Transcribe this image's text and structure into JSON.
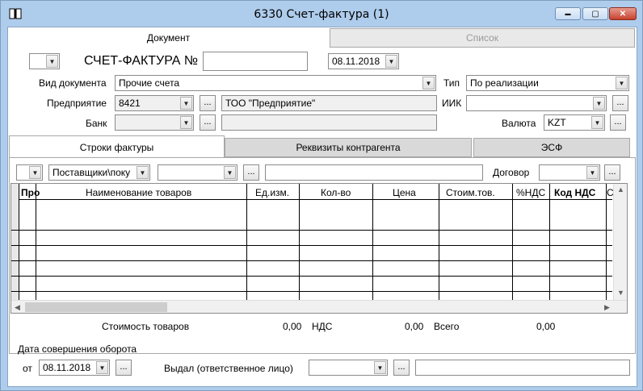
{
  "window": {
    "title": "6330 Счет-фактура (1)",
    "minimize": "▬",
    "maximize": "▢",
    "close": "✕"
  },
  "top_tabs": {
    "document": "Документ",
    "list": "Список"
  },
  "header": {
    "doc_title": "СЧЕТ-ФАКТУРА №",
    "number_value": "",
    "date_value": "08.11.2018",
    "doc_type_label": "Вид документа",
    "doc_type_value": "Прочие счета",
    "type_label": "Тип",
    "type_value": "По реализации",
    "enterprise_label": "Предприятие",
    "enterprise_code": "8421",
    "enterprise_name": "ТОО \"Предприятие\"",
    "iik_label": "ИИК",
    "iik_value": "",
    "bank_label": "Банк",
    "bank_value": "",
    "currency_label": "Валюта",
    "currency_value": "KZT"
  },
  "inner_tabs": {
    "rows": "Строки фактуры",
    "requisites": "Реквизиты контрагента",
    "esf": "ЭСФ"
  },
  "filter": {
    "supplier_value": "Поставщики\\поку",
    "contract_label": "Договор"
  },
  "grid": {
    "columns": [
      "Про",
      "Наименование товаров",
      "Ед.изм.",
      "Кол-во",
      "Цена",
      "Стоим.тов.",
      "%НДС",
      "Код НДС",
      "С"
    ],
    "empty_rows": 6
  },
  "totals": {
    "goods_label": "Стоимость товаров",
    "goods_value": "0,00",
    "vat_label": "НДС",
    "vat_value": "0,00",
    "total_label": "Всего",
    "total_value": "0,00"
  },
  "footer": {
    "turnover_label": "Дата совершения оборота",
    "from_label": "от",
    "from_date": "08.11.2018",
    "issued_label": "Выдал (ответственное лицо)"
  },
  "ui": {
    "dots": "...",
    "dropdown_arrow": "▼"
  },
  "colors": {
    "window_frame": "#aeccec",
    "client_bg": "#ffffff",
    "readonly_field": "#f0f0f0"
  }
}
